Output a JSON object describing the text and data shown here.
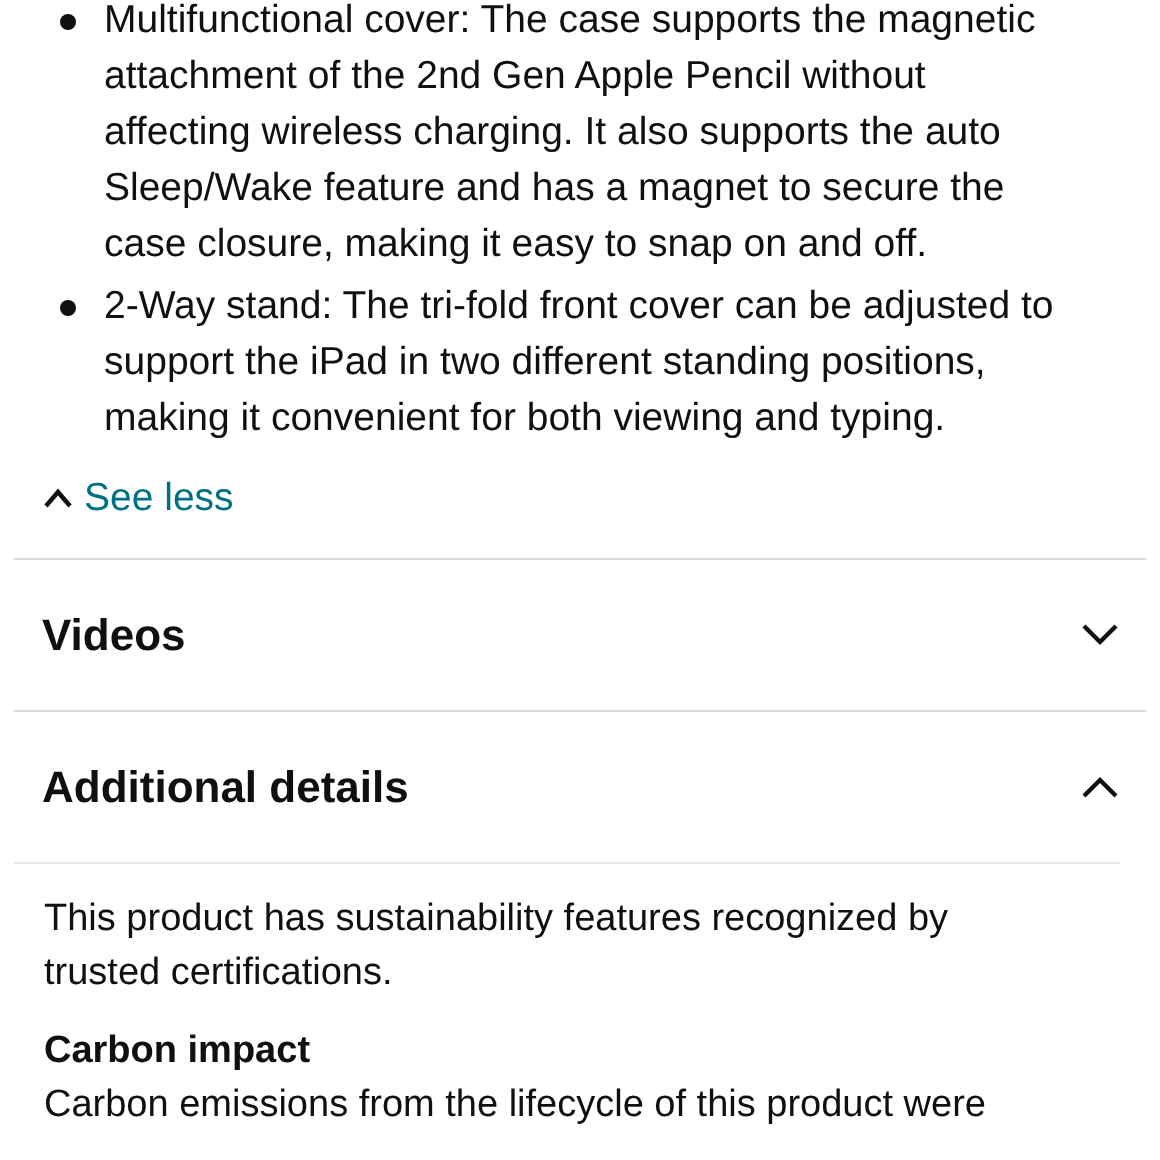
{
  "bullets": [
    "Multifunctional cover: The case supports the magnetic attachment of the 2nd Gen Apple Pencil without affecting wireless charging. It also supports the auto Sleep/Wake feature and has a magnet to secure the case closure, making it easy to snap on and off.",
    "2-Way stand: The tri-fold front cover can be adjusted to support the iPad in two different standing positions, making it convenient for both viewing and typing."
  ],
  "see_less": "See less",
  "sections": [
    {
      "title": "Videos",
      "expanded": false
    },
    {
      "title": "Additional details",
      "expanded": true
    }
  ],
  "details": {
    "intro": "This product has sustainability features recognized by trusted certifications.",
    "heading": "Carbon impact",
    "text": "Carbon emissions from the lifecycle of this product were"
  }
}
